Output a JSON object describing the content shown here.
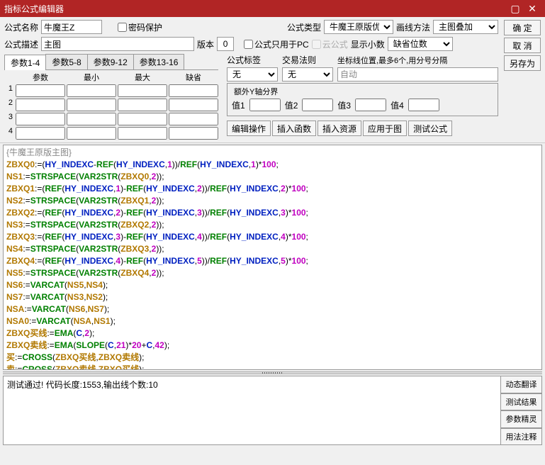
{
  "window": {
    "title": "指标公式编辑器"
  },
  "labels": {
    "name": "公式名称",
    "pwd": "密码保护",
    "type": "公式类型",
    "drawmethod": "画线方法",
    "desc": "公式描述",
    "version": "版本",
    "pconly": "公式只用于PC",
    "cloud": "云公式",
    "showdec": "显示小数",
    "defpos": "缺省位数",
    "formulatag": "公式标签",
    "tradelaw": "交易法则",
    "coordhint": "坐标线位置,最多6个,用分号分隔",
    "extray": "额外Y轴分界",
    "v1": "值1",
    "v2": "值2",
    "v3": "值3",
    "v4": "值4"
  },
  "inputs": {
    "name": "牛魔王Z",
    "desc": "主图",
    "version": "0",
    "coord": "自动"
  },
  "selects": {
    "type": "牛魔王原版优化",
    "drawmethod": "主图叠加",
    "defpos": "缺省位数",
    "tag": "无",
    "tradelaw": "无"
  },
  "btns": {
    "ok": "确 定",
    "cancel": "取 消",
    "saveas": "另存为",
    "editop": "编辑操作",
    "insfunc": "插入函数",
    "insres": "插入资源",
    "apply": "应用于图",
    "test": "测试公式",
    "dyntrans": "动态翻译",
    "testres": "测试结果",
    "paramwiz": "参数精灵",
    "usage": "用法注释"
  },
  "tabs": {
    "t1": "参数1-4",
    "t2": "参数5-8",
    "t3": "参数9-12",
    "t4": "参数13-16",
    "h1": "参数",
    "h2": "最小",
    "h3": "最大",
    "h4": "缺省"
  },
  "code": {
    "title": "{牛魔王原版主图}"
  },
  "status": {
    "msg": "测试通过! 代码长度:1553,输出线个数:10"
  }
}
